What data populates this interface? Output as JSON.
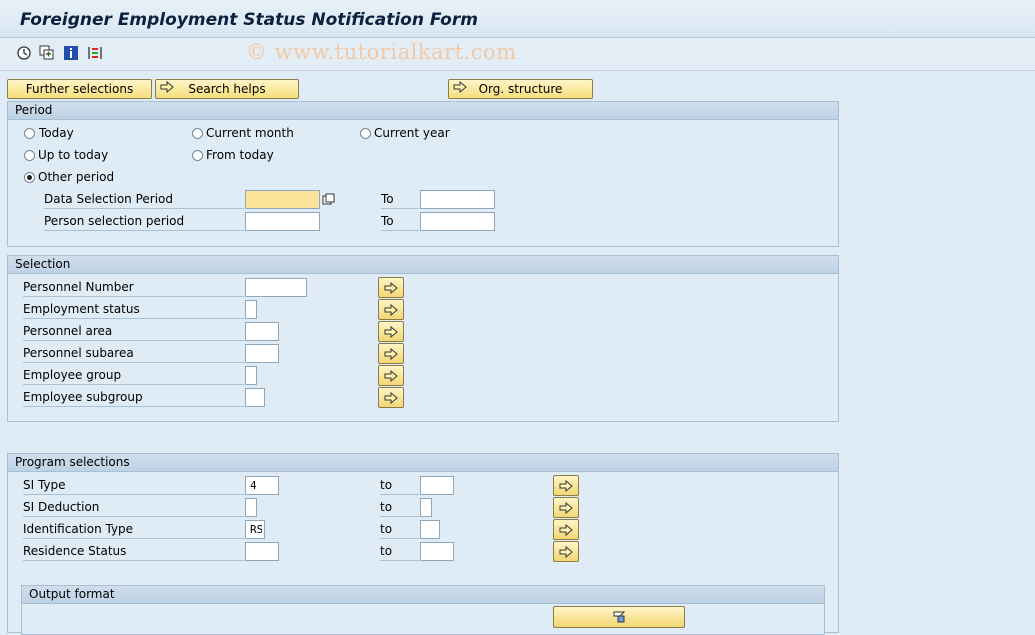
{
  "window": {
    "title": "Foreigner Employment Status Notification Form"
  },
  "toolbar": {
    "icons": [
      "execute-icon",
      "variant-icon",
      "info-icon",
      "selection-options-icon"
    ],
    "watermark": "© www.tutorialkart.com"
  },
  "buttons": {
    "further_selections": "Further selections",
    "search_helps": "Search helps",
    "org_structure": "Org. structure"
  },
  "period": {
    "title": "Period",
    "radios": {
      "today": "Today",
      "current_month": "Current month",
      "current_year": "Current year",
      "up_to_today": "Up to today",
      "from_today": "From today",
      "other_period": "Other period"
    },
    "selected": "other_period",
    "data_selection_label": "Data Selection Period",
    "person_selection_label": "Person selection period",
    "to_label": "To",
    "data_from": "",
    "data_to": "",
    "person_from": "",
    "person_to": ""
  },
  "selection": {
    "title": "Selection",
    "rows": [
      {
        "label": "Personnel Number",
        "value": ""
      },
      {
        "label": "Employment status",
        "value": ""
      },
      {
        "label": "Personnel area",
        "value": ""
      },
      {
        "label": "Personnel subarea",
        "value": ""
      },
      {
        "label": "Employee group",
        "value": ""
      },
      {
        "label": "Employee subgroup",
        "value": ""
      }
    ]
  },
  "program": {
    "title": "Program selections",
    "to_label": "to",
    "rows": [
      {
        "label": "SI Type",
        "from": "4",
        "to": ""
      },
      {
        "label": "SI Deduction",
        "from": "",
        "to": ""
      },
      {
        "label": "Identification Type",
        "from": "RS",
        "to": ""
      },
      {
        "label": "Residence Status",
        "from": "",
        "to": ""
      }
    ]
  },
  "output": {
    "title": "Output format"
  }
}
